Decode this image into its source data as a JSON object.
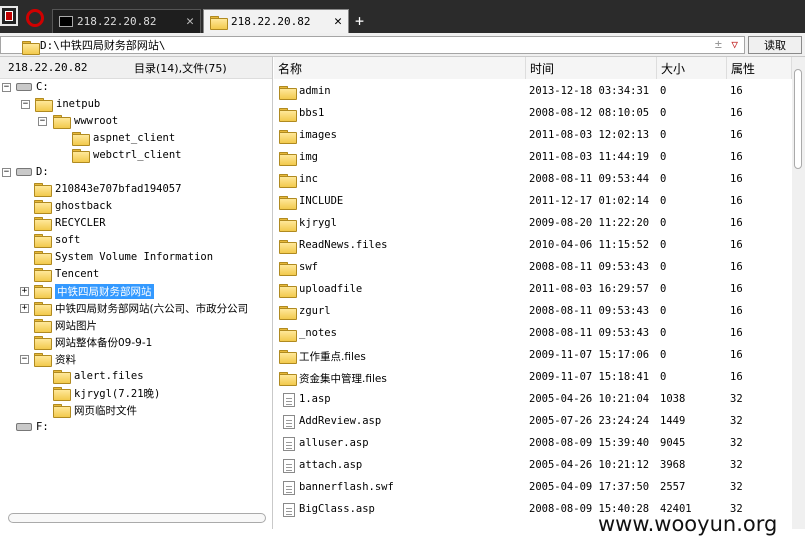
{
  "tabs": [
    {
      "label": "218.22.20.82",
      "active": false
    },
    {
      "label": "218.22.20.82",
      "active": true
    }
  ],
  "tab_close": "✕",
  "new_tab": "+",
  "address": {
    "path": "D:\\中铁四局财务部网站\\",
    "plus": "±",
    "arrow": "▽"
  },
  "read_button": "读取",
  "left_header": {
    "ip": "218.22.20.82",
    "counts": "目录(14),文件(75)"
  },
  "tree": [
    {
      "label": "C:",
      "type": "drive"
    },
    {
      "label": "inetpub",
      "type": "folder"
    },
    {
      "label": "wwwroot",
      "type": "folder"
    },
    {
      "label": "aspnet_client",
      "type": "folder"
    },
    {
      "label": "webctrl_client",
      "type": "folder"
    },
    {
      "label": "D:",
      "type": "drive"
    },
    {
      "label": "210843e707bfad194057",
      "type": "folder"
    },
    {
      "label": "ghostback",
      "type": "folder"
    },
    {
      "label": "RECYCLER",
      "type": "folder"
    },
    {
      "label": "soft",
      "type": "folder"
    },
    {
      "label": "System Volume Information",
      "type": "folder"
    },
    {
      "label": "Tencent",
      "type": "folder"
    },
    {
      "label": "中铁四局财务部网站",
      "type": "folder"
    },
    {
      "label": "中铁四局财务部网站(六公司、市政分公司",
      "type": "folder"
    },
    {
      "label": "网站图片",
      "type": "folder"
    },
    {
      "label": "网站整体备份09-9-1",
      "type": "folder"
    },
    {
      "label": "资料",
      "type": "folder"
    },
    {
      "label": "alert.files",
      "type": "folder"
    },
    {
      "label": "kjrygl(7.21晚)",
      "type": "folder"
    },
    {
      "label": "网页临时文件",
      "type": "folder"
    },
    {
      "label": "F:",
      "type": "drive"
    }
  ],
  "columns": {
    "name": "名称",
    "time": "时间",
    "size": "大小",
    "attr": "属性"
  },
  "files": [
    {
      "name": "admin",
      "time": "2013-12-18 03:34:31",
      "size": "0",
      "attr": "16",
      "type": "folder"
    },
    {
      "name": "bbs1",
      "time": "2008-08-12 08:10:05",
      "size": "0",
      "attr": "16",
      "type": "folder"
    },
    {
      "name": "images",
      "time": "2011-08-03 12:02:13",
      "size": "0",
      "attr": "16",
      "type": "folder"
    },
    {
      "name": "img",
      "time": "2011-08-03 11:44:19",
      "size": "0",
      "attr": "16",
      "type": "folder"
    },
    {
      "name": "inc",
      "time": "2008-08-11 09:53:44",
      "size": "0",
      "attr": "16",
      "type": "folder"
    },
    {
      "name": "INCLUDE",
      "time": "2011-12-17 01:02:14",
      "size": "0",
      "attr": "16",
      "type": "folder"
    },
    {
      "name": "kjrygl",
      "time": "2009-08-20 11:22:20",
      "size": "0",
      "attr": "16",
      "type": "folder"
    },
    {
      "name": "ReadNews.files",
      "time": "2010-04-06 11:15:52",
      "size": "0",
      "attr": "16",
      "type": "folder"
    },
    {
      "name": "swf",
      "time": "2008-08-11 09:53:43",
      "size": "0",
      "attr": "16",
      "type": "folder"
    },
    {
      "name": "uploadfile",
      "time": "2011-08-03 16:29:57",
      "size": "0",
      "attr": "16",
      "type": "folder"
    },
    {
      "name": "zgurl",
      "time": "2008-08-11 09:53:43",
      "size": "0",
      "attr": "16",
      "type": "folder"
    },
    {
      "name": "_notes",
      "time": "2008-08-11 09:53:43",
      "size": "0",
      "attr": "16",
      "type": "folder"
    },
    {
      "name": "工作重点.files",
      "time": "2009-11-07 15:17:06",
      "size": "0",
      "attr": "16",
      "type": "folder"
    },
    {
      "name": "资金集中管理.files",
      "time": "2009-11-07 15:18:41",
      "size": "0",
      "attr": "16",
      "type": "folder"
    },
    {
      "name": "1.asp",
      "time": "2005-04-26 10:21:04",
      "size": "1038",
      "attr": "32",
      "type": "file"
    },
    {
      "name": "AddReview.asp",
      "time": "2005-07-26 23:24:24",
      "size": "1449",
      "attr": "32",
      "type": "file"
    },
    {
      "name": "alluser.asp",
      "time": "2008-08-09 15:39:40",
      "size": "9045",
      "attr": "32",
      "type": "file"
    },
    {
      "name": "attach.asp",
      "time": "2005-04-26 10:21:12",
      "size": "3968",
      "attr": "32",
      "type": "file"
    },
    {
      "name": "bannerflash.swf",
      "time": "2005-04-09 17:37:50",
      "size": "2557",
      "attr": "32",
      "type": "file"
    },
    {
      "name": "BigClass.asp",
      "time": "2008-08-09 15:40:28",
      "size": "42401",
      "attr": "32",
      "type": "file"
    }
  ],
  "watermark": "www.wooyun.org"
}
